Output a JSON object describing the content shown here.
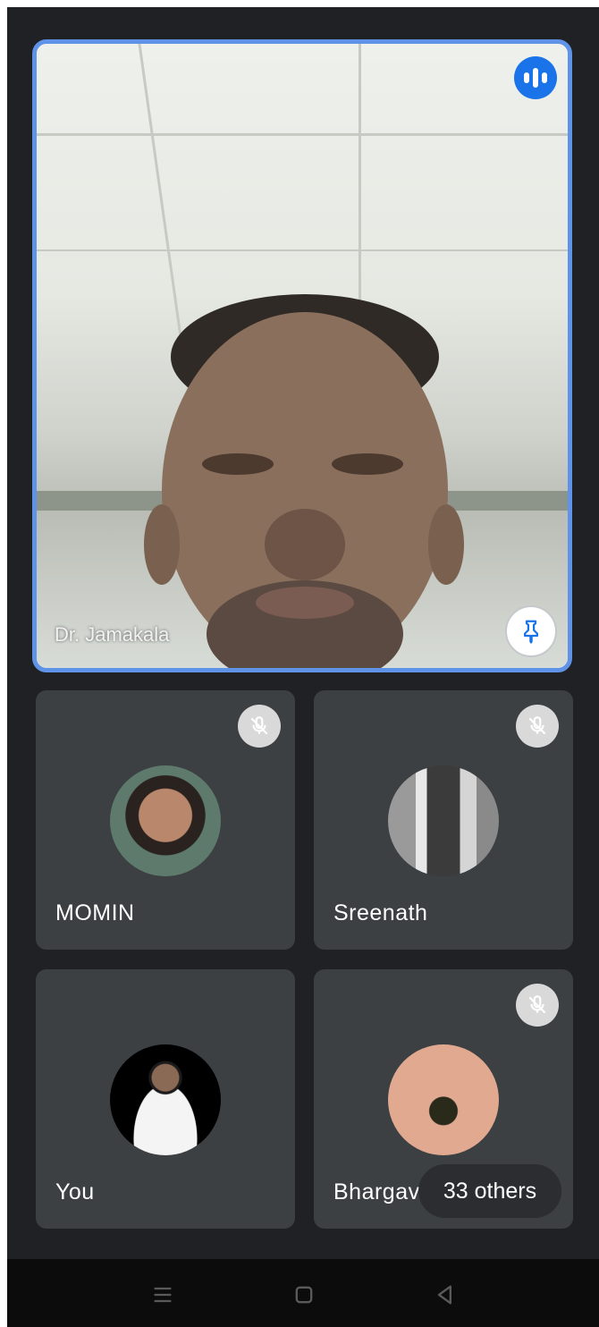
{
  "main_speaker": {
    "name": "Dr. Jamakala",
    "speaking_icon": "speaking-indicator-icon",
    "pin_icon": "pin-icon"
  },
  "participants": [
    {
      "name": "MOMIN",
      "muted": true
    },
    {
      "name": "Sreenath",
      "muted": true
    },
    {
      "name": "You",
      "muted": false
    },
    {
      "name": "Bhargavi",
      "muted": true
    }
  ],
  "others_label": "33 others",
  "nav": {
    "recents_icon": "recents-icon",
    "home_icon": "home-icon",
    "back_icon": "back-icon"
  },
  "colors": {
    "background": "#202124",
    "tile": "#3c4043",
    "active_speaker_border": "#5f93e8",
    "speaking_badge": "#1a73e8"
  }
}
